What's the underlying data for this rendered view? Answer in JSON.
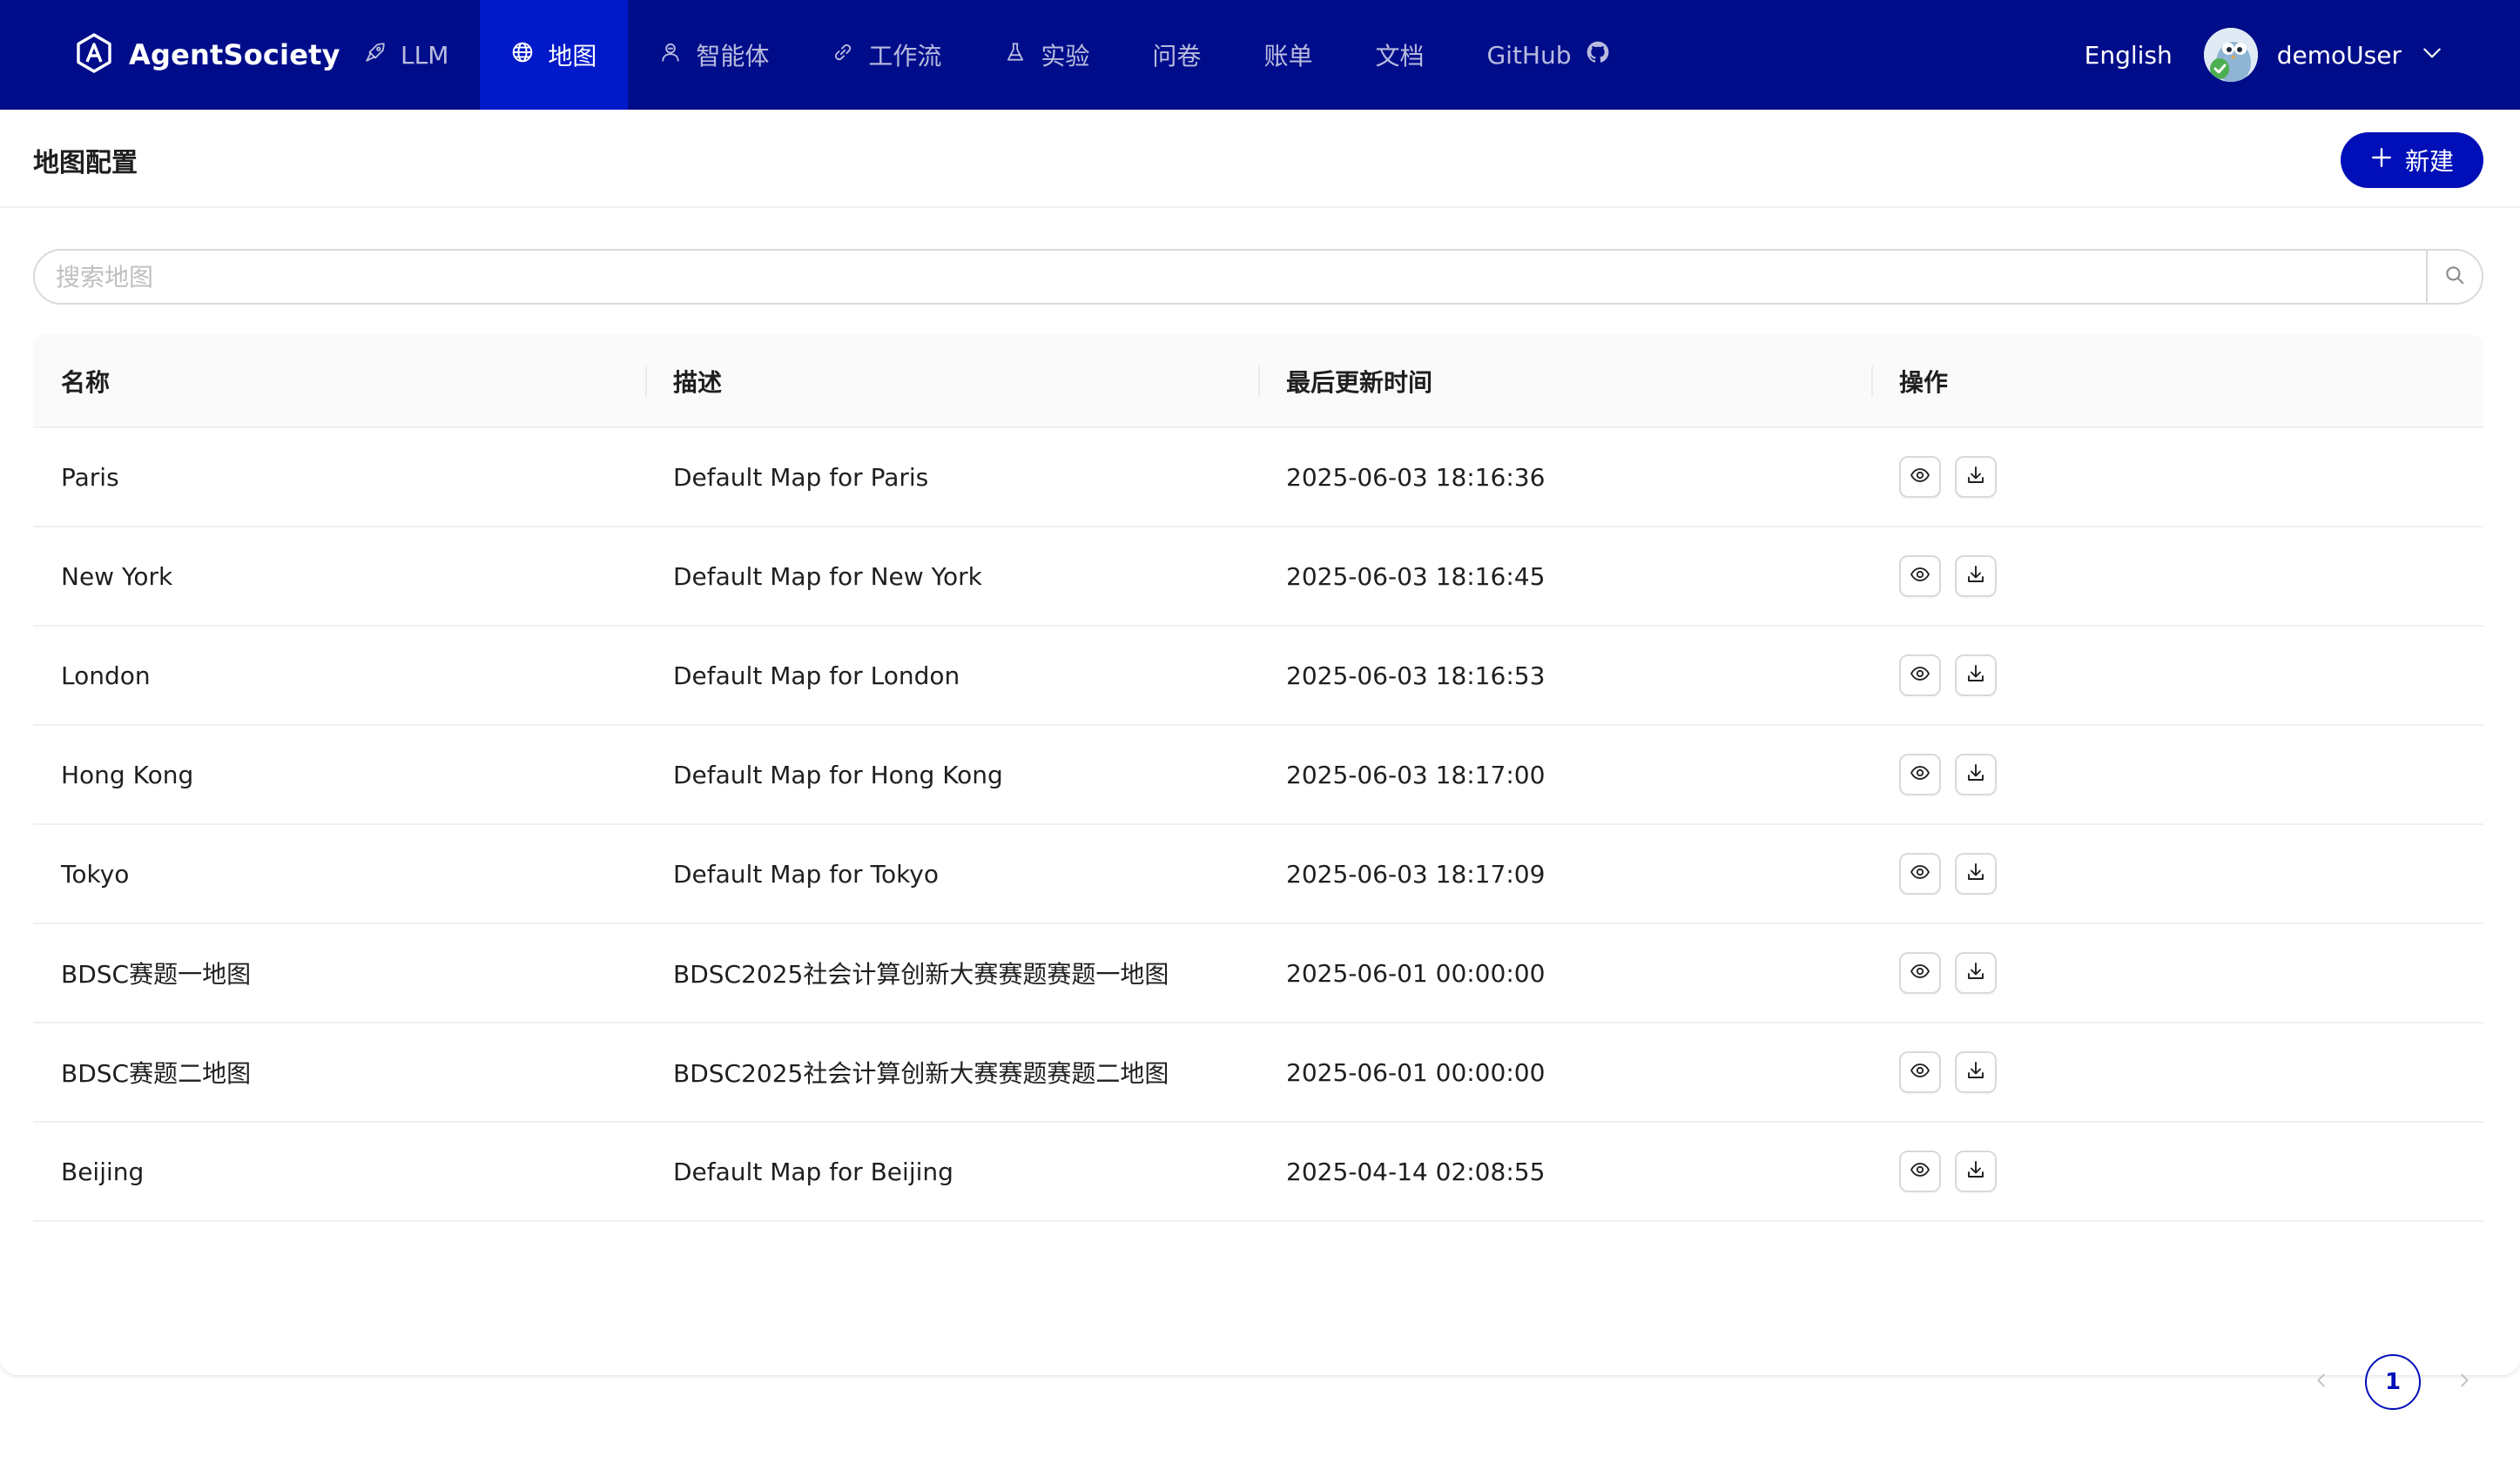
{
  "brand": {
    "name": "AgentSociety",
    "icon": "agentsociety-logo-icon"
  },
  "nav": {
    "items": [
      {
        "label": "LLM",
        "icon": "rocket-icon",
        "active": false
      },
      {
        "label": "地图",
        "icon": "globe-icon",
        "active": true
      },
      {
        "label": "智能体",
        "icon": "robot-icon",
        "active": false
      },
      {
        "label": "工作流",
        "icon": "link-icon",
        "active": false
      },
      {
        "label": "实验",
        "icon": "flask-icon",
        "active": false
      },
      {
        "label": "问卷",
        "icon": "",
        "active": false
      },
      {
        "label": "账单",
        "icon": "",
        "active": false
      },
      {
        "label": "文档",
        "icon": "",
        "active": false
      },
      {
        "label": "GitHub",
        "icon": "github-icon",
        "active": false
      }
    ],
    "language": "English",
    "username": "demoUser"
  },
  "page": {
    "title": "地图配置",
    "new_button": "新建"
  },
  "search": {
    "placeholder": "搜索地图",
    "value": ""
  },
  "table": {
    "columns": [
      "名称",
      "描述",
      "最后更新时间",
      "操作"
    ],
    "rows": [
      {
        "name": "Paris",
        "description": "Default Map for Paris",
        "updated": "2025-06-03 18:16:36"
      },
      {
        "name": "New York",
        "description": "Default Map for New York",
        "updated": "2025-06-03 18:16:45"
      },
      {
        "name": "London",
        "description": "Default Map for London",
        "updated": "2025-06-03 18:16:53"
      },
      {
        "name": "Hong Kong",
        "description": "Default Map for Hong Kong",
        "updated": "2025-06-03 18:17:00"
      },
      {
        "name": "Tokyo",
        "description": "Default Map for Tokyo",
        "updated": "2025-06-03 18:17:09"
      },
      {
        "name": "BDSC赛题一地图",
        "description": "BDSC2025社会计算创新大赛赛题赛题一地图",
        "updated": "2025-06-01 00:00:00"
      },
      {
        "name": "BDSC赛题二地图",
        "description": "BDSC2025社会计算创新大赛赛题赛题二地图",
        "updated": "2025-06-01 00:00:00"
      },
      {
        "name": "Beijing",
        "description": "Default Map for Beijing",
        "updated": "2025-04-14 02:08:55"
      }
    ],
    "row_actions": [
      "eye-icon",
      "download-icon"
    ]
  },
  "pagination": {
    "current_page": "1"
  },
  "colors": {
    "nav_bg": "#000d8a",
    "nav_active": "#0019c9",
    "primary": "#000fb8"
  }
}
